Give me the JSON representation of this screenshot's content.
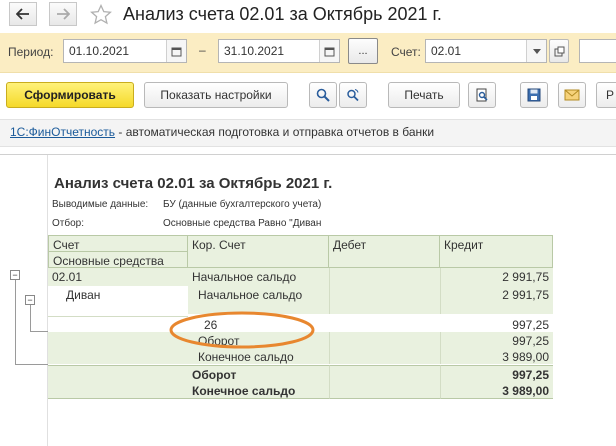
{
  "window": {
    "title": "Анализ счета 02.01 за Октябрь 2021 г."
  },
  "params": {
    "period_label": "Период:",
    "date_from": "01.10.2021",
    "date_to": "31.10.2021",
    "dash": "–",
    "ellipsis_label": "...",
    "account_label": "Счет:",
    "account_value": "02.01"
  },
  "toolbar": {
    "generate_label": "Сформировать",
    "show_settings_label": "Показать настройки",
    "print_label": "Печать"
  },
  "info": {
    "link_text": "1С:ФинОтчетность",
    "text": " - автоматическая подготовка и отправка отчетов в банки"
  },
  "report": {
    "title": "Анализ счета 02.01 за Октябрь 2021 г.",
    "shown_data_label": "Выводимые данные:",
    "shown_data_value": "БУ (данные бухгалтерского учета)",
    "filter_label": "Отбор:",
    "filter_value": "Основные средства Равно \"Диван",
    "headers": {
      "account": "Счет",
      "corr_account": "Кор. Счет",
      "debit": "Дебет",
      "credit": "Кредит",
      "subheader": "Основные средства"
    },
    "rows": {
      "r1_account": "02.01",
      "r1_label": "Начальное сальдо",
      "r1_credit": "2 991,75",
      "r2_account": "Диван",
      "r2_label": "Начальное сальдо",
      "r2_credit": "2 991,75",
      "r3_corr": "26",
      "r3_credit": "997,25",
      "r4_label": "Оборот",
      "r4_credit": "997,25",
      "r5_label": "Конечное сальдо",
      "r5_credit": "3 989,00",
      "total_turnover_label": "Оборот",
      "total_turnover_credit": "997,25",
      "total_end_label": "Конечное сальдо",
      "total_end_credit": "3 989,00"
    }
  },
  "colors": {
    "param_bar": "#fbedc3",
    "table_green": "#e9f1df",
    "highlight_oval": "#e8872f",
    "primary_button": "#f5d92a"
  }
}
